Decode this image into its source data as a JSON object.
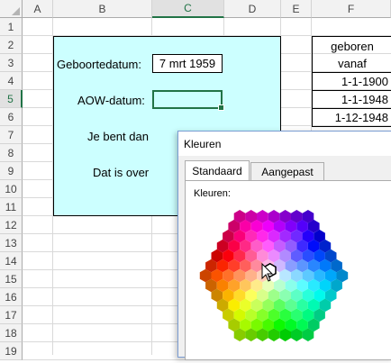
{
  "columns": [
    "A",
    "B",
    "C",
    "D",
    "E",
    "F"
  ],
  "selected_column": "C",
  "rows": [
    "1",
    "2",
    "3",
    "4",
    "5",
    "6",
    "7",
    "8",
    "9",
    "10",
    "11",
    "12",
    "13",
    "14",
    "15",
    "16",
    "17",
    "18",
    "19"
  ],
  "selected_row": "5",
  "form": {
    "birth_label": "Geboortedatum:",
    "birth_value": "7 mrt 1959",
    "aow_label": "AOW-datum:",
    "age_label": "Je bent dan",
    "remaining_label": "Dat is over"
  },
  "table_f": {
    "header_line1": "geboren",
    "header_line2": "vanaf",
    "values": [
      "1-1-1900",
      "1-1-1948",
      "1-12-1948"
    ]
  },
  "dialog": {
    "title": "Kleuren",
    "tab_standard": "Standaard",
    "tab_custom": "Aangepast",
    "colors_label": "Kleuren:"
  },
  "colors": {
    "selection_green": "#217346",
    "cell_fill": "#ccffff",
    "dialog_border": "#7a9cd3"
  },
  "icons": {
    "cursor": "mouse-pointer-icon",
    "selected_swatch": "white-hexagon-selection"
  }
}
